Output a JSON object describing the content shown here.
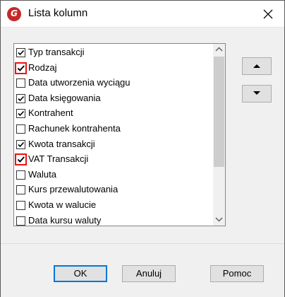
{
  "window": {
    "title": "Lista kolumn"
  },
  "columns": [
    {
      "label": "Typ transakcji",
      "checked": true,
      "highlighted": false
    },
    {
      "label": "Rodzaj",
      "checked": true,
      "highlighted": true
    },
    {
      "label": "Data utworzenia wyciągu",
      "checked": false,
      "highlighted": false
    },
    {
      "label": "Data księgowania",
      "checked": true,
      "highlighted": false
    },
    {
      "label": "Kontrahent",
      "checked": true,
      "highlighted": false
    },
    {
      "label": "Rachunek kontrahenta",
      "checked": false,
      "highlighted": false
    },
    {
      "label": "Kwota transakcji",
      "checked": true,
      "highlighted": false
    },
    {
      "label": "VAT Transakcji",
      "checked": true,
      "highlighted": true
    },
    {
      "label": "Waluta",
      "checked": false,
      "highlighted": false
    },
    {
      "label": "Kurs przewalutowania",
      "checked": false,
      "highlighted": false
    },
    {
      "label": "Kwota w walucie",
      "checked": false,
      "highlighted": false
    },
    {
      "label": "Data kursu waluty",
      "checked": false,
      "highlighted": false
    }
  ],
  "buttons": {
    "ok": "OK",
    "cancel": "Anuluj",
    "help": "Pomoc"
  },
  "icons": {
    "app": "app-logo-icon",
    "close": "close-icon",
    "move_up": "arrow-up-icon",
    "move_down": "arrow-down-icon"
  },
  "colors": {
    "highlight": "#e11111",
    "accent": "#0078d7"
  }
}
